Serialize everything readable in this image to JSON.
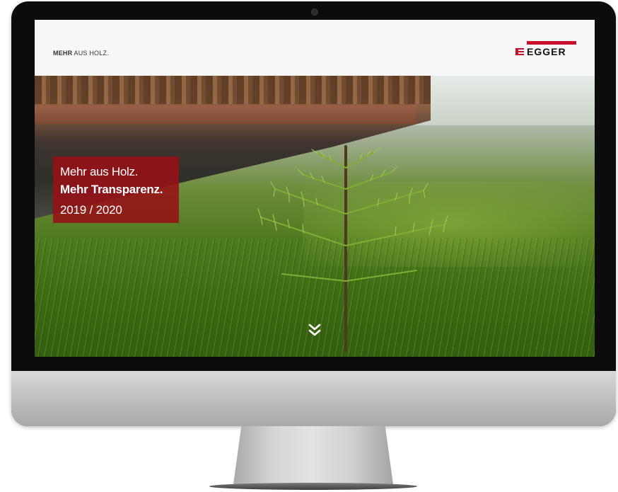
{
  "header": {
    "tagline_bold": "MEHR",
    "tagline_rest": "AUS HOLZ.",
    "logo_text": "EGGER"
  },
  "hero": {
    "line1": "Mehr aus Holz.",
    "line2": "Mehr Transparenz.",
    "line3": "2019 / 2020"
  },
  "icons": {
    "scroll": "double-chevron-down-icon",
    "logo": "egger-logo"
  },
  "colors": {
    "brand_red": "#c8102e",
    "title_box": "#96101a"
  }
}
